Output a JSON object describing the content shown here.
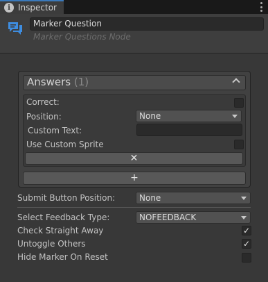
{
  "window": {
    "tab_label": "Inspector",
    "tab_icon": "info-icon",
    "menu_icon": "kebab-menu-icon"
  },
  "header": {
    "icon": "comment-icon",
    "name_value": "Marker Question",
    "subtitle": "Marker Questions Node"
  },
  "answers": {
    "title": "Answers",
    "count": "(1)",
    "element": {
      "correct_label": "Correct:",
      "correct_checked": false,
      "position_label": "Position:",
      "position_value": "None",
      "custom_text_label": "Custom Text:",
      "custom_text_value": "",
      "use_custom_sprite_label": "Use Custom Sprite",
      "use_custom_sprite_checked": false,
      "remove_glyph": "✕"
    },
    "add_glyph": "+"
  },
  "submit": {
    "label": "Submit Button Position:",
    "value": "None"
  },
  "feedback": {
    "label": "Select Feedback Type:",
    "value": "NOFEEDBACK"
  },
  "toggles": [
    {
      "label": "Check Straight Away",
      "checked": true,
      "mark": "✓"
    },
    {
      "label": "Untoggle Others",
      "checked": true,
      "mark": "✓"
    },
    {
      "label": "Hide Marker On Reset",
      "checked": false,
      "mark": ""
    }
  ],
  "colors": {
    "panel": "#383838",
    "tab_accent": "#3a79bb",
    "comment_icon": "#3e8de0"
  }
}
